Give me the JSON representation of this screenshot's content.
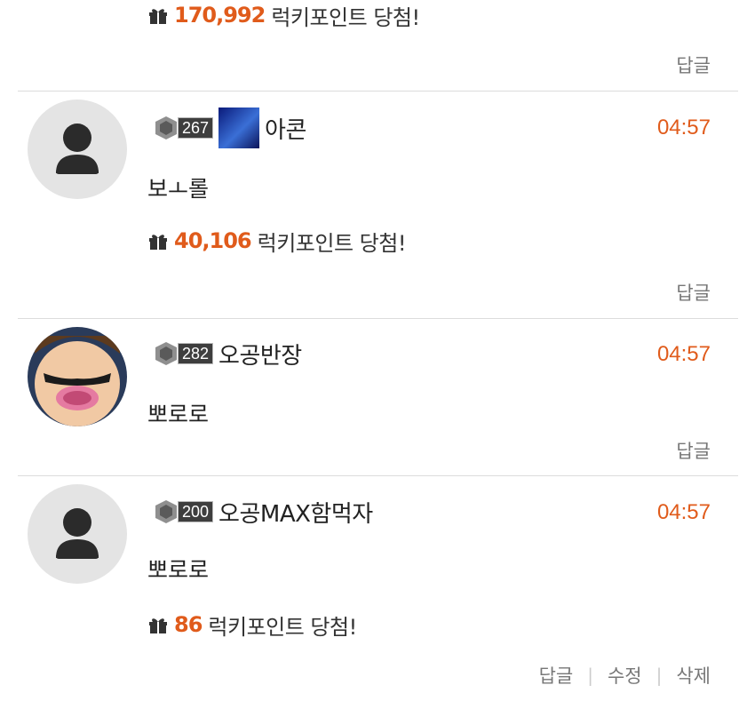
{
  "top": {
    "luck_amount": "170,992",
    "luck_label": "럭키포인트 당첨!",
    "reply": "답글"
  },
  "comments": [
    {
      "level": "267",
      "nickname": "아콘",
      "time": "04:57",
      "text": "보ㅗ롤",
      "luck_amount": "40,106",
      "luck_label": "럭키포인트 당첨!",
      "reply": "답글"
    },
    {
      "level": "282",
      "nickname": "오공반장",
      "time": "04:57",
      "text": "뽀로로",
      "reply": "답글"
    },
    {
      "level": "200",
      "nickname": "오공MAX함먹자",
      "time": "04:57",
      "text": "뽀로로",
      "luck_amount": "86",
      "luck_label": "럭키포인트 당첨!",
      "reply": "답글",
      "edit": "수정",
      "delete": "삭제"
    }
  ],
  "icons": {
    "gift": "gift-icon",
    "person": "person-icon",
    "level": "level-emblem-icon"
  },
  "colors": {
    "accent": "#e05b1b",
    "divider": "#dcdcdc",
    "avatar_bg": "#e4e4e4"
  }
}
